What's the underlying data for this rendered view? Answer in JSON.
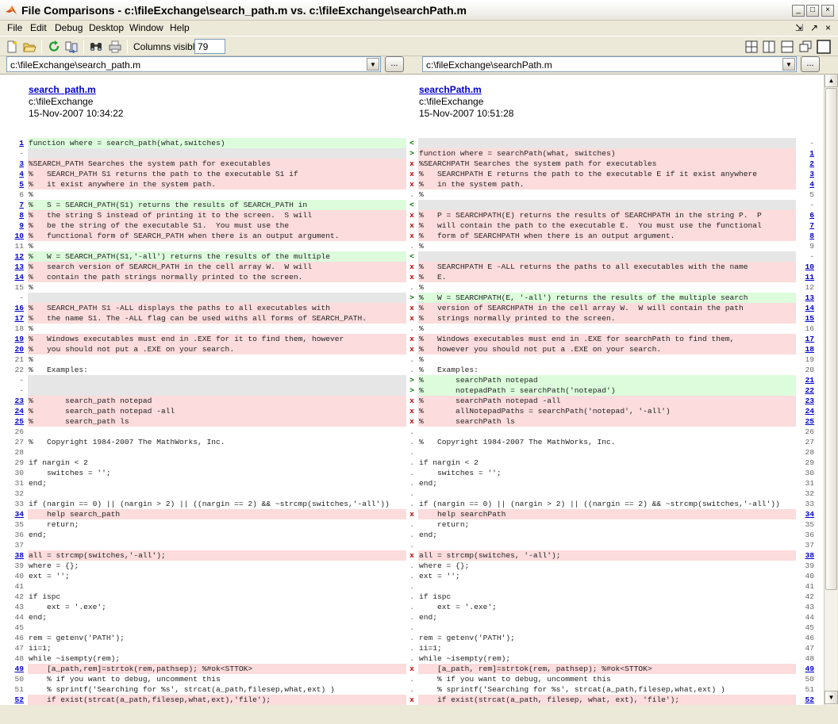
{
  "window": {
    "title": "File Comparisons - c:\\fileExchange\\search_path.m vs. c:\\fileExchange\\searchPath.m",
    "minimize_glyph": "_",
    "maximize_glyph": "□",
    "close_glyph": "×"
  },
  "menu": [
    "File",
    "Edit",
    "Debug",
    "Desktop",
    "Window",
    "Help"
  ],
  "menu_right": [
    "⇲",
    "↗",
    "×"
  ],
  "toolbar": {
    "columns_label": "Columns visible:",
    "columns_value": "79"
  },
  "left_file": {
    "path_combo": "c:\\fileExchange\\search_path.m",
    "name": "search_path.m",
    "dir": "c:\\fileExchange",
    "date": "15-Nov-2007 10:34:22"
  },
  "right_file": {
    "path_combo": "c:\\fileExchange\\searchPath.m",
    "name": "searchPath.m",
    "dir": "c:\\fileExchange",
    "date": "15-Nov-2007 10:51:28"
  },
  "browse_label": "...",
  "colors": {
    "diff_bg": "#fcdcdc",
    "left_only_bg": "#dcfcdc",
    "blank_bg": "#e6e6e6"
  },
  "lines": [
    {
      "ln": "1",
      "lt": "function where = search_path(what,switches)",
      "m": "<",
      "rn": "-",
      "rt": "",
      "t": "lonly"
    },
    {
      "ln": "-",
      "lt": "",
      "m": ">",
      "rn": "1",
      "rt": "function where = searchPath(what, switches)",
      "t": "ronly_blank"
    },
    {
      "ln": "3",
      "lt": "%SEARCH_PATH Searches the system path for executables",
      "m": "x",
      "rn": "2",
      "rt": "%SEARCHPATH Searches the system path for executables",
      "t": "diff"
    },
    {
      "ln": "4",
      "lt": "%   SEARCH_PATH S1 returns the path to the executable S1 if",
      "m": "x",
      "rn": "3",
      "rt": "%   SEARCHPATH E returns the path to the executable E if it exist anywhere",
      "t": "diff"
    },
    {
      "ln": "5",
      "lt": "%   it exist anywhere in the system path.",
      "m": "x",
      "rn": "4",
      "rt": "%   in the system path.",
      "t": "diff"
    },
    {
      "ln": "6",
      "lt": "%",
      "m": ".",
      "rn": "5",
      "rt": "%",
      "t": "same"
    },
    {
      "ln": "7",
      "lt": "%   S = SEARCH_PATH(S1) returns the results of SEARCH_PATH in",
      "m": "<",
      "rn": "-",
      "rt": "",
      "t": "lonly"
    },
    {
      "ln": "8",
      "lt": "%   the string S instead of printing it to the screen.  S will",
      "m": "x",
      "rn": "6",
      "rt": "%   P = SEARCHPATH(E) returns the results of SEARCHPATH in the string P.  P",
      "t": "diff"
    },
    {
      "ln": "9",
      "lt": "%   be the string of the executable S1.  You must use the",
      "m": "x",
      "rn": "7",
      "rt": "%   will contain the path to the executable E.  You must use the functional",
      "t": "diff"
    },
    {
      "ln": "10",
      "lt": "%   functional form of SEARCH_PATH when there is an output argument.",
      "m": "x",
      "rn": "8",
      "rt": "%   form of SEARCHPATH when there is an output argument.",
      "t": "diff"
    },
    {
      "ln": "11",
      "lt": "%",
      "m": ".",
      "rn": "9",
      "rt": "%",
      "t": "same"
    },
    {
      "ln": "12",
      "lt": "%   W = SEARCH_PATH(S1,'-all') returns the results of the multiple",
      "m": "<",
      "rn": "-",
      "rt": "",
      "t": "lonly"
    },
    {
      "ln": "13",
      "lt": "%   search version of SEARCH_PATH in the cell array W.  W will",
      "m": "x",
      "rn": "10",
      "rt": "%   SEARCHPATH E -ALL returns the paths to all executables with the name",
      "t": "diff"
    },
    {
      "ln": "14",
      "lt": "%   contain the path strings normally printed to the screen.",
      "m": "x",
      "rn": "11",
      "rt": "%   E.",
      "t": "diff"
    },
    {
      "ln": "15",
      "lt": "%",
      "m": ".",
      "rn": "12",
      "rt": "%",
      "t": "same"
    },
    {
      "ln": "-",
      "lt": "",
      "m": ">",
      "rn": "13",
      "rt": "%   W = SEARCHPATH(E, '-all') returns the results of the multiple search",
      "t": "ronly"
    },
    {
      "ln": "16",
      "lt": "%   SEARCH_PATH S1 -ALL displays the paths to all executables with",
      "m": "x",
      "rn": "14",
      "rt": "%   version of SEARCHPATH in the cell array W.  W will contain the path",
      "t": "diff"
    },
    {
      "ln": "17",
      "lt": "%   the name S1. The -ALL flag can be used withs all forms of SEARCH_PATH.",
      "m": "x",
      "rn": "15",
      "rt": "%   strings normally printed to the screen.",
      "t": "diff"
    },
    {
      "ln": "18",
      "lt": "%",
      "m": ".",
      "rn": "16",
      "rt": "%",
      "t": "same"
    },
    {
      "ln": "19",
      "lt": "%   Windows executables must end in .EXE for it to find them, however",
      "m": "x",
      "rn": "17",
      "rt": "%   Windows executables must end in .EXE for searchPath to find them,",
      "t": "diff"
    },
    {
      "ln": "20",
      "lt": "%   you should not put a .EXE on your search.",
      "m": "x",
      "rn": "18",
      "rt": "%   however you should not put a .EXE on your search.",
      "t": "diff"
    },
    {
      "ln": "21",
      "lt": "%",
      "m": ".",
      "rn": "19",
      "rt": "%",
      "t": "same"
    },
    {
      "ln": "22",
      "lt": "%   Examples:",
      "m": ".",
      "rn": "20",
      "rt": "%   Examples:",
      "t": "same"
    },
    {
      "ln": "-",
      "lt": "",
      "m": ">",
      "rn": "21",
      "rt": "%       searchPath notepad",
      "t": "ronly"
    },
    {
      "ln": "-",
      "lt": "",
      "m": ">",
      "rn": "22",
      "rt": "%       notepadPath = searchPath('notepad')",
      "t": "ronly"
    },
    {
      "ln": "23",
      "lt": "%       search_path notepad",
      "m": "x",
      "rn": "23",
      "rt": "%       searchPath notepad -all",
      "t": "diff"
    },
    {
      "ln": "24",
      "lt": "%       search_path notepad -all",
      "m": "x",
      "rn": "24",
      "rt": "%       allNotepadPaths = searchPath('notepad', '-all')",
      "t": "diff"
    },
    {
      "ln": "25",
      "lt": "%       search_path ls",
      "m": "x",
      "rn": "25",
      "rt": "%       searchPath ls",
      "t": "diff"
    },
    {
      "ln": "26",
      "lt": "",
      "m": ".",
      "rn": "26",
      "rt": "",
      "t": "same"
    },
    {
      "ln": "27",
      "lt": "%   Copyright 1984-2007 The MathWorks, Inc.",
      "m": ".",
      "rn": "27",
      "rt": "%   Copyright 1984-2007 The MathWorks, Inc.",
      "t": "same"
    },
    {
      "ln": "28",
      "lt": "",
      "m": ".",
      "rn": "28",
      "rt": "",
      "t": "same"
    },
    {
      "ln": "29",
      "lt": "if nargin < 2",
      "m": ".",
      "rn": "29",
      "rt": "if nargin < 2",
      "t": "same"
    },
    {
      "ln": "30",
      "lt": "    switches = '';",
      "m": ".",
      "rn": "30",
      "rt": "    switches = '';",
      "t": "same"
    },
    {
      "ln": "31",
      "lt": "end;",
      "m": ".",
      "rn": "31",
      "rt": "end;",
      "t": "same"
    },
    {
      "ln": "32",
      "lt": "",
      "m": ".",
      "rn": "32",
      "rt": "",
      "t": "same"
    },
    {
      "ln": "33",
      "lt": "if (nargin == 0) || (nargin > 2) || ((nargin == 2) && ~strcmp(switches,'-all'))",
      "m": ".",
      "rn": "33",
      "rt": "if (nargin == 0) || (nargin > 2) || ((nargin == 2) && ~strcmp(switches,'-all'))",
      "t": "same"
    },
    {
      "ln": "34",
      "lt": "    help search_path",
      "m": "x",
      "rn": "34",
      "rt": "    help searchPath",
      "t": "diff"
    },
    {
      "ln": "35",
      "lt": "    return;",
      "m": ".",
      "rn": "35",
      "rt": "    return;",
      "t": "same"
    },
    {
      "ln": "36",
      "lt": "end;",
      "m": ".",
      "rn": "36",
      "rt": "end;",
      "t": "same"
    },
    {
      "ln": "37",
      "lt": "",
      "m": ".",
      "rn": "37",
      "rt": "",
      "t": "same"
    },
    {
      "ln": "38",
      "lt": "all = strcmp(switches,'-all');",
      "m": "x",
      "rn": "38",
      "rt": "all = strcmp(switches, '-all');",
      "t": "diff"
    },
    {
      "ln": "39",
      "lt": "where = {};",
      "m": ".",
      "rn": "39",
      "rt": "where = {};",
      "t": "same"
    },
    {
      "ln": "40",
      "lt": "ext = '';",
      "m": ".",
      "rn": "40",
      "rt": "ext = '';",
      "t": "same"
    },
    {
      "ln": "41",
      "lt": "",
      "m": ".",
      "rn": "41",
      "rt": "",
      "t": "same"
    },
    {
      "ln": "42",
      "lt": "if ispc",
      "m": ".",
      "rn": "42",
      "rt": "if ispc",
      "t": "same"
    },
    {
      "ln": "43",
      "lt": "    ext = '.exe';",
      "m": ".",
      "rn": "43",
      "rt": "    ext = '.exe';",
      "t": "same"
    },
    {
      "ln": "44",
      "lt": "end;",
      "m": ".",
      "rn": "44",
      "rt": "end;",
      "t": "same"
    },
    {
      "ln": "45",
      "lt": "",
      "m": ".",
      "rn": "45",
      "rt": "",
      "t": "same"
    },
    {
      "ln": "46",
      "lt": "rem = getenv('PATH');",
      "m": ".",
      "rn": "46",
      "rt": "rem = getenv('PATH');",
      "t": "same"
    },
    {
      "ln": "47",
      "lt": "ii=1;",
      "m": ".",
      "rn": "47",
      "rt": "ii=1;",
      "t": "same"
    },
    {
      "ln": "48",
      "lt": "while ~isempty(rem);",
      "m": ".",
      "rn": "48",
      "rt": "while ~isempty(rem);",
      "t": "same"
    },
    {
      "ln": "49",
      "lt": "    [a_path,rem]=strtok(rem,pathsep); %#ok<STTOK>",
      "m": "x",
      "rn": "49",
      "rt": "    [a_path, rem]=strtok(rem, pathsep); %#ok<STTOK>",
      "t": "diff"
    },
    {
      "ln": "50",
      "lt": "    % if you want to debug, uncomment this",
      "m": ".",
      "rn": "50",
      "rt": "    % if you want to debug, uncomment this",
      "t": "same"
    },
    {
      "ln": "51",
      "lt": "    % sprintf('Searching for %s', strcat(a_path,filesep,what,ext) )",
      "m": ".",
      "rn": "51",
      "rt": "    % sprintf('Searching for %s', strcat(a_path,filesep,what,ext) )",
      "t": "same"
    },
    {
      "ln": "52",
      "lt": "    if exist(strcat(a_path,filesep,what,ext),'file');",
      "m": "x",
      "rn": "52",
      "rt": "    if exist(strcat(a_path, filesep, what, ext), 'file');",
      "t": "diff"
    }
  ]
}
